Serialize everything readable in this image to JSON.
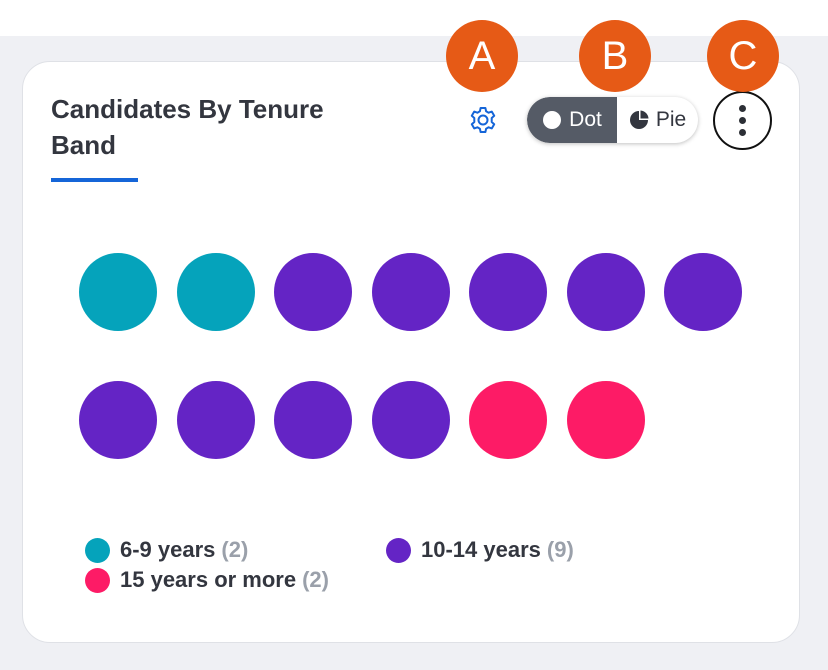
{
  "card": {
    "title": "Candidates By Tenure Band"
  },
  "toolbar": {
    "settings_icon": "gear-icon",
    "view_toggle": {
      "options": [
        {
          "label": "Dot",
          "icon": "circle-icon",
          "selected": true
        },
        {
          "label": "Pie",
          "icon": "pie-icon",
          "selected": false
        }
      ]
    },
    "more_icon": "vertical-ellipsis-icon"
  },
  "markers": [
    "A",
    "B",
    "C"
  ],
  "chart_data": {
    "type": "dot",
    "categories": [
      "6-9 years",
      "10-14 years",
      "15 years or more"
    ],
    "values": [
      2,
      9,
      2
    ],
    "colors": [
      "#05a3bb",
      "#6424c5",
      "#fd1b66"
    ],
    "per_row": 7
  },
  "legend": {
    "items": [
      {
        "label": "6-9 years",
        "count": "(2)",
        "color": "#05a3bb"
      },
      {
        "label": "10-14 years",
        "count": "(9)",
        "color": "#6424c5"
      },
      {
        "label": "15 years or more",
        "count": "(2)",
        "color": "#fd1b66"
      }
    ]
  },
  "colors": {
    "accent": "#1565d8",
    "marker": "#e65a16",
    "toggle_active": "#555b66"
  }
}
